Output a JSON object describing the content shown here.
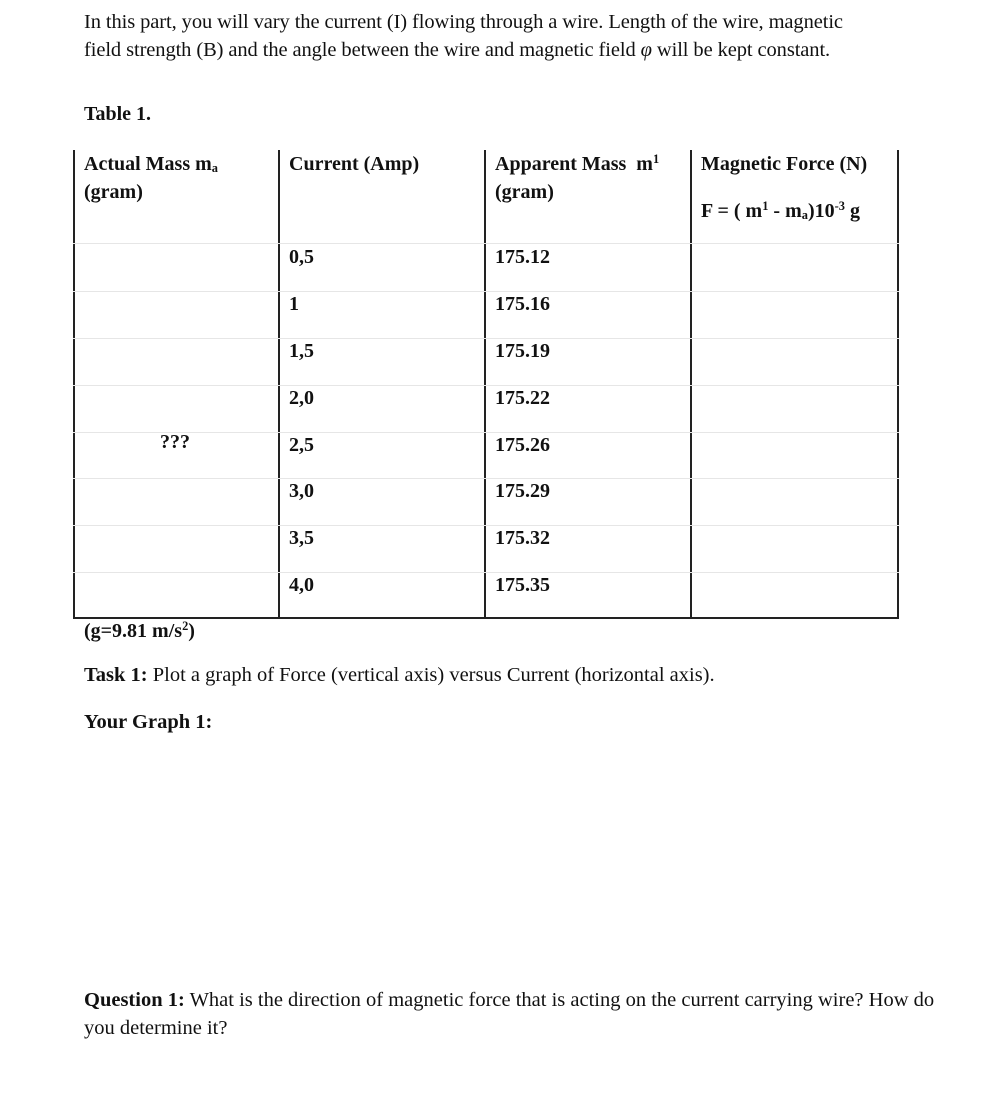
{
  "intro": {
    "line1": "In this part, you will vary the current (I) flowing through a wire. Length of the wire, magnetic",
    "line2_before_symbol": "field strength (B) and the angle between the wire and magnetic field ",
    "symbol": "φ",
    "line2_after_symbol": " will be kept constant."
  },
  "table": {
    "caption": "Table 1.",
    "headers": {
      "actual_mass": {
        "text": "Actual Mass m",
        "sub": "a",
        "line2": "(gram)"
      },
      "current": {
        "text": "Current (Amp)"
      },
      "apparent_mass": {
        "text": "Apparent Mass  m",
        "sup": "1",
        "line2": "(gram)"
      },
      "magnetic_force": {
        "text": "Magnetic Force (N)",
        "formula_prefix": "F = ( m",
        "formula_sup1": "1",
        "formula_mid": " - m",
        "formula_sub": "a",
        "formula_pow": ")10",
        "formula_exp": "-3",
        "formula_suffix": " g"
      }
    },
    "actual_mass_value": "???",
    "rows": [
      {
        "current": "0,5",
        "apparent_mass": "175.12",
        "magnetic_force": ""
      },
      {
        "current": "1",
        "apparent_mass": "175.16",
        "magnetic_force": ""
      },
      {
        "current": "1,5",
        "apparent_mass": "175.19",
        "magnetic_force": ""
      },
      {
        "current": "2,0",
        "apparent_mass": "175.22",
        "magnetic_force": ""
      },
      {
        "current": "2,5",
        "apparent_mass": "175.26",
        "magnetic_force": ""
      },
      {
        "current": "3,0",
        "apparent_mass": "175.29",
        "magnetic_force": ""
      },
      {
        "current": "3,5",
        "apparent_mass": "175.32",
        "magnetic_force": ""
      },
      {
        "current": "4,0",
        "apparent_mass": "175.35",
        "magnetic_force": ""
      }
    ]
  },
  "g_note": {
    "prefix": "(g=9.81 m/s",
    "sup": "2",
    "suffix": ")"
  },
  "task1": {
    "label": "Task 1:",
    "text": " Plot a graph of Force (vertical axis) versus Current (horizontal axis)."
  },
  "graph1": {
    "label": "Your Graph 1:"
  },
  "question1": {
    "label": "Question 1:",
    "text": " What is the direction of magnetic force that is acting on the current carrying wire? How do you determine it?"
  }
}
